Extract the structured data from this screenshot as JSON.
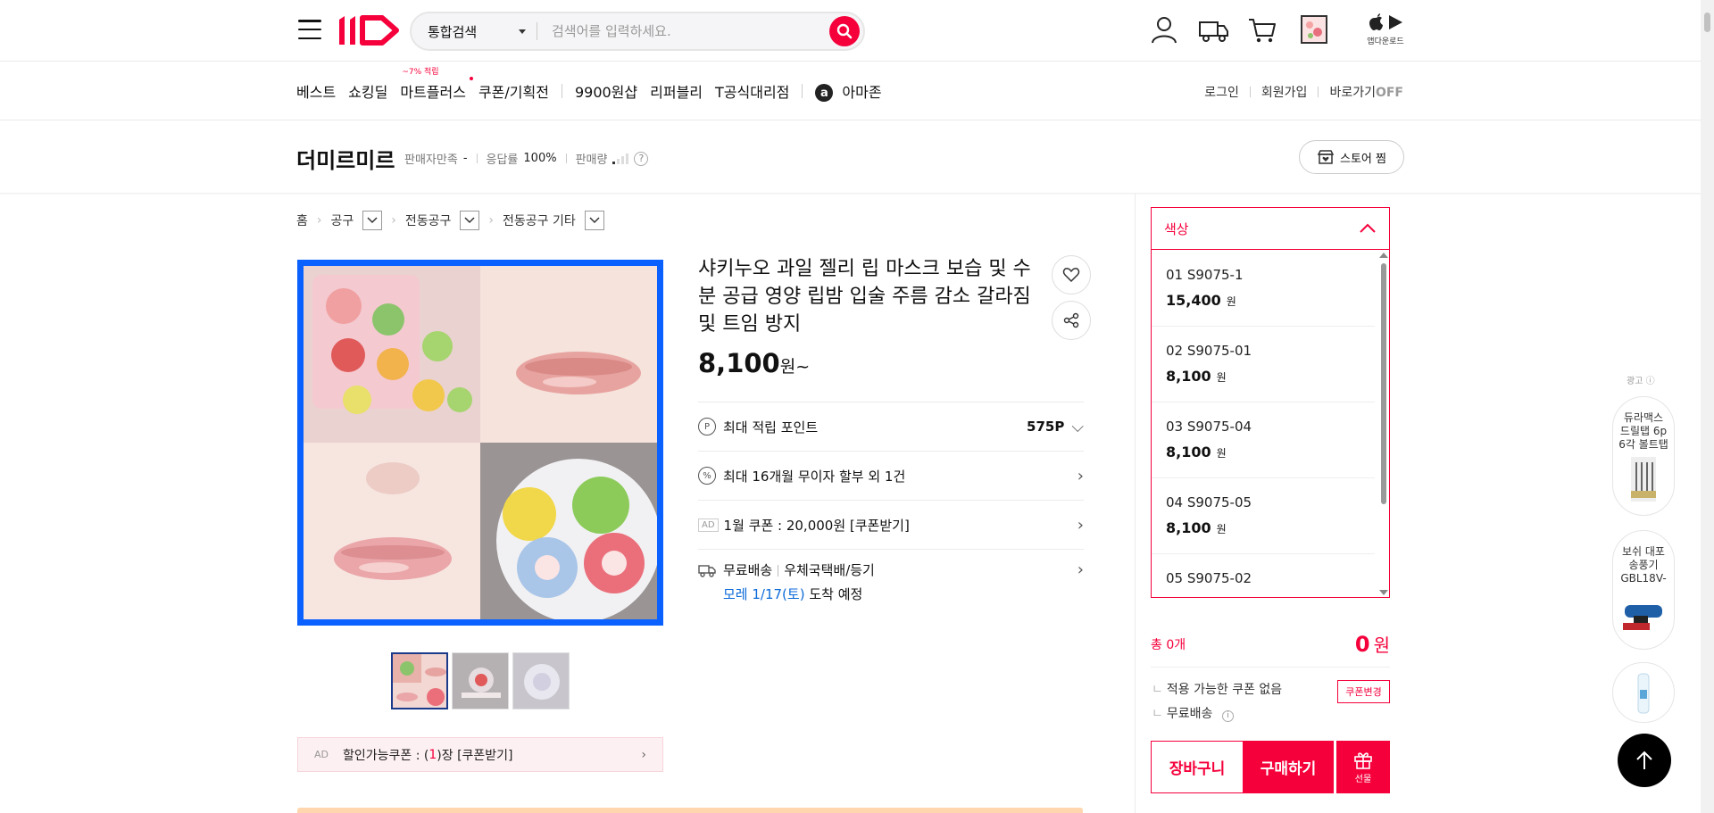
{
  "header": {
    "search_scope": "통합검색",
    "search_placeholder": "검색어를 입력하세요.",
    "app_download": "앱다운로드"
  },
  "nav": {
    "items": [
      "베스트",
      "쇼킹딜",
      "마트플러스",
      "쿠폰/기획전",
      "9900원샵",
      "리퍼블리",
      "T공식대리점",
      "아마존"
    ],
    "mart_tag": "~7% 적립"
  },
  "account": {
    "login": "로그인",
    "signup": "회원가입",
    "shortcut": "바로가기",
    "shortcut_state": "OFF"
  },
  "store": {
    "name": "더미르미르",
    "satisfaction_label": "판매자만족",
    "satisfaction_value": "-",
    "response_label": "응답률",
    "response_value": "100%",
    "sales_label": "판매량",
    "follow_button": "스토어 찜"
  },
  "breadcrumb": [
    "홈",
    "공구",
    "전동공구",
    "전동공구 기타"
  ],
  "product": {
    "title": "샤키누오 과일 젤리 립 마스크 보습 및 수분 공급 영양 립밤 입술 주름 감소 갈라짐 및 트임 방지",
    "price": "8,100",
    "price_suffix": "원~"
  },
  "benefits": {
    "points_label": "최대 적립 포인트",
    "points_value": "575P",
    "installment": "최대 16개월 무이자 할부 외 1건",
    "ad_tag": "AD",
    "coupon": "1월 쿠폰 : 20,000원 [쿠폰받기]",
    "ship_free": "무료배송",
    "ship_method": "우체국택배/등기",
    "ship_date": "모레 1/17(토)",
    "ship_arrive": "도착 예정"
  },
  "coupon_bar": {
    "ad": "AD",
    "text_pre": "할인가능쿠폰 : (",
    "count": "1",
    "text_post": ")장 [쿠폰받기]"
  },
  "options": {
    "header": "색상",
    "items": [
      {
        "name": "01 S9075-1",
        "price": "15,400",
        "unit": "원"
      },
      {
        "name": "02 S9075-01",
        "price": "8,100",
        "unit": "원"
      },
      {
        "name": "03 S9075-04",
        "price": "8,100",
        "unit": "원"
      },
      {
        "name": "04 S9075-05",
        "price": "8,100",
        "unit": "원"
      },
      {
        "name": "05 S9075-02",
        "price": "",
        "unit": ""
      }
    ]
  },
  "order": {
    "total_label": "총 0개",
    "total_amount": "0",
    "total_unit": "원",
    "no_coupon": "적용 가능한 쿠폰 없음",
    "coupon_change": "쿠폰변경",
    "free_ship": "무료배송",
    "cart": "장바구니",
    "buy": "구매하기",
    "gift": "선물"
  },
  "side_ads": {
    "label": "광고",
    "ad1": "듀라맥스 드릴탭 6p 6각 볼트탭",
    "ad2": "보쉬 대포 송풍기 GBL18V-"
  },
  "colors": {
    "accent": "#f5003b",
    "image_border": "#0b61ff",
    "link_blue": "#0b6ad8"
  }
}
